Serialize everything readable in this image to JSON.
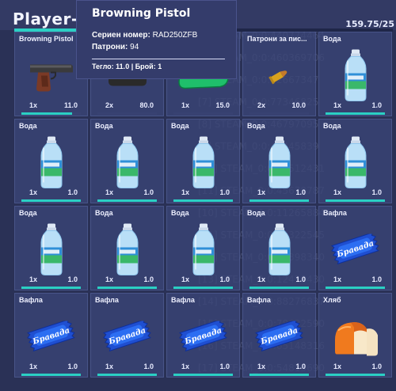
{
  "header": {
    "player_name": "Player-127",
    "weight": "159.75/25",
    "weight_fill": 0.56,
    "accent": "#2bd0c4"
  },
  "background_log": [
    "[13] STEAM_0:0:463692808",
    "[4] STEAM_0:0:440774464",
    "[5] STEAM_0:0:460369706",
    "[6] STEAM_0:0:42667347",
    "[7] STEAM_0:0:77346825",
    "[8] STEAM_0:0:46797095",
    "[9] STEAM_0:0:46445839",
    "[10] STEAM_0:0:85512431",
    "[11] STEAM_0:0:45678787",
    "[10] STEAM_0:0:112658846",
    "[11] STEAM_0:0:55322545",
    "[12] STEAM_0:0:79398340",
    "[13] STEAM_0:0:12410430",
    "[14] STEAM_0:0:88276837",
    "[15] STEAM_0:0:78632590",
    "[16] STEAM_0:0:65148316",
    "[17] STEAM_0:0:54813690"
  ],
  "tooltip": {
    "title": "Browning Pistol",
    "serial_label": "Сериен номер:",
    "serial_value": "RAD250ZFB",
    "ammo_label": "Патрони:",
    "ammo_value": "94",
    "footer": "Тегло: 11.0 | Брой: 1"
  },
  "inventory": [
    {
      "label": "Browning Pistol",
      "qty": "1x",
      "amount": "11.0",
      "icon": "pistol-icon",
      "bar": 0.85
    },
    {
      "label": "",
      "qty": "2x",
      "amount": "80.0",
      "icon": "vest-icon",
      "bar": 0
    },
    {
      "label": "",
      "qty": "1x",
      "amount": "15.0",
      "icon": "bag-icon",
      "bar": 0
    },
    {
      "label": "Патрони за пис...",
      "qty": "2x",
      "amount": "10.0",
      "icon": "bullet-icon",
      "bar": 0
    },
    {
      "label": "Вода",
      "qty": "1x",
      "amount": "1.0",
      "icon": "water-bottle-icon",
      "bar": 1
    },
    {
      "label": "Вода",
      "qty": "1x",
      "amount": "1.0",
      "icon": "water-bottle-icon",
      "bar": 1
    },
    {
      "label": "Вода",
      "qty": "1x",
      "amount": "1.0",
      "icon": "water-bottle-icon",
      "bar": 1
    },
    {
      "label": "Вода",
      "qty": "1x",
      "amount": "1.0",
      "icon": "water-bottle-icon",
      "bar": 1
    },
    {
      "label": "Вода",
      "qty": "1x",
      "amount": "1.0",
      "icon": "water-bottle-icon",
      "bar": 1
    },
    {
      "label": "Вода",
      "qty": "1x",
      "amount": "1.0",
      "icon": "water-bottle-icon",
      "bar": 1
    },
    {
      "label": "Вода",
      "qty": "1x",
      "amount": "1.0",
      "icon": "water-bottle-icon",
      "bar": 1
    },
    {
      "label": "Вода",
      "qty": "1x",
      "amount": "1.0",
      "icon": "water-bottle-icon",
      "bar": 1
    },
    {
      "label": "Вода",
      "qty": "1x",
      "amount": "1.0",
      "icon": "water-bottle-icon",
      "bar": 1
    },
    {
      "label": "Вода",
      "qty": "1x",
      "amount": "1.0",
      "icon": "water-bottle-icon",
      "bar": 1
    },
    {
      "label": "Вафла",
      "qty": "1x",
      "amount": "1.0",
      "icon": "wafer-icon",
      "bar": 1
    },
    {
      "label": "Вафла",
      "qty": "1x",
      "amount": "1.0",
      "icon": "wafer-icon",
      "bar": 1
    },
    {
      "label": "Вафла",
      "qty": "1x",
      "amount": "1.0",
      "icon": "wafer-icon",
      "bar": 1
    },
    {
      "label": "Вафла",
      "qty": "1x",
      "amount": "1.0",
      "icon": "wafer-icon",
      "bar": 1
    },
    {
      "label": "Вафла",
      "qty": "1x",
      "amount": "1.0",
      "icon": "wafer-icon",
      "bar": 1
    },
    {
      "label": "Хляб",
      "qty": "1x",
      "amount": "1.0",
      "icon": "bread-icon",
      "bar": 1
    }
  ]
}
